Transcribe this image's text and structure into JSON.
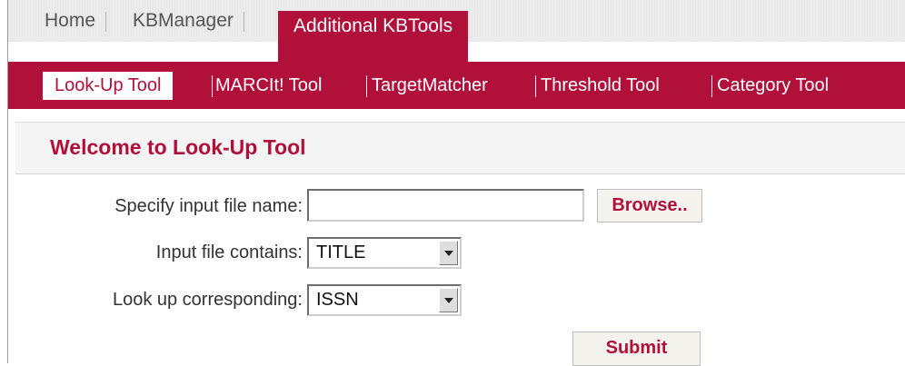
{
  "top_nav": {
    "items": [
      {
        "label": "Home"
      },
      {
        "label": "KBManager"
      },
      {
        "label": "Additional KBTools",
        "active": true
      }
    ]
  },
  "sub_nav": {
    "items": [
      {
        "label": "Look-Up Tool",
        "active": true
      },
      {
        "label": "MARCIt! Tool"
      },
      {
        "label": "TargetMatcher"
      },
      {
        "label": "Threshold Tool"
      },
      {
        "label": "Category Tool"
      }
    ]
  },
  "page": {
    "title": "Welcome to Look-Up Tool"
  },
  "form": {
    "file_label": "Specify input file name:",
    "file_value": "",
    "browse_label": "Browse..",
    "contains_label": "Input file contains:",
    "contains_value": "TITLE",
    "lookup_label": "Look up corresponding:",
    "lookup_value": "ISSN",
    "submit_label": "Submit"
  },
  "colors": {
    "brand": "#b0103a",
    "tab_strip": "#ececec",
    "header_bg": "#f4f4f4"
  }
}
